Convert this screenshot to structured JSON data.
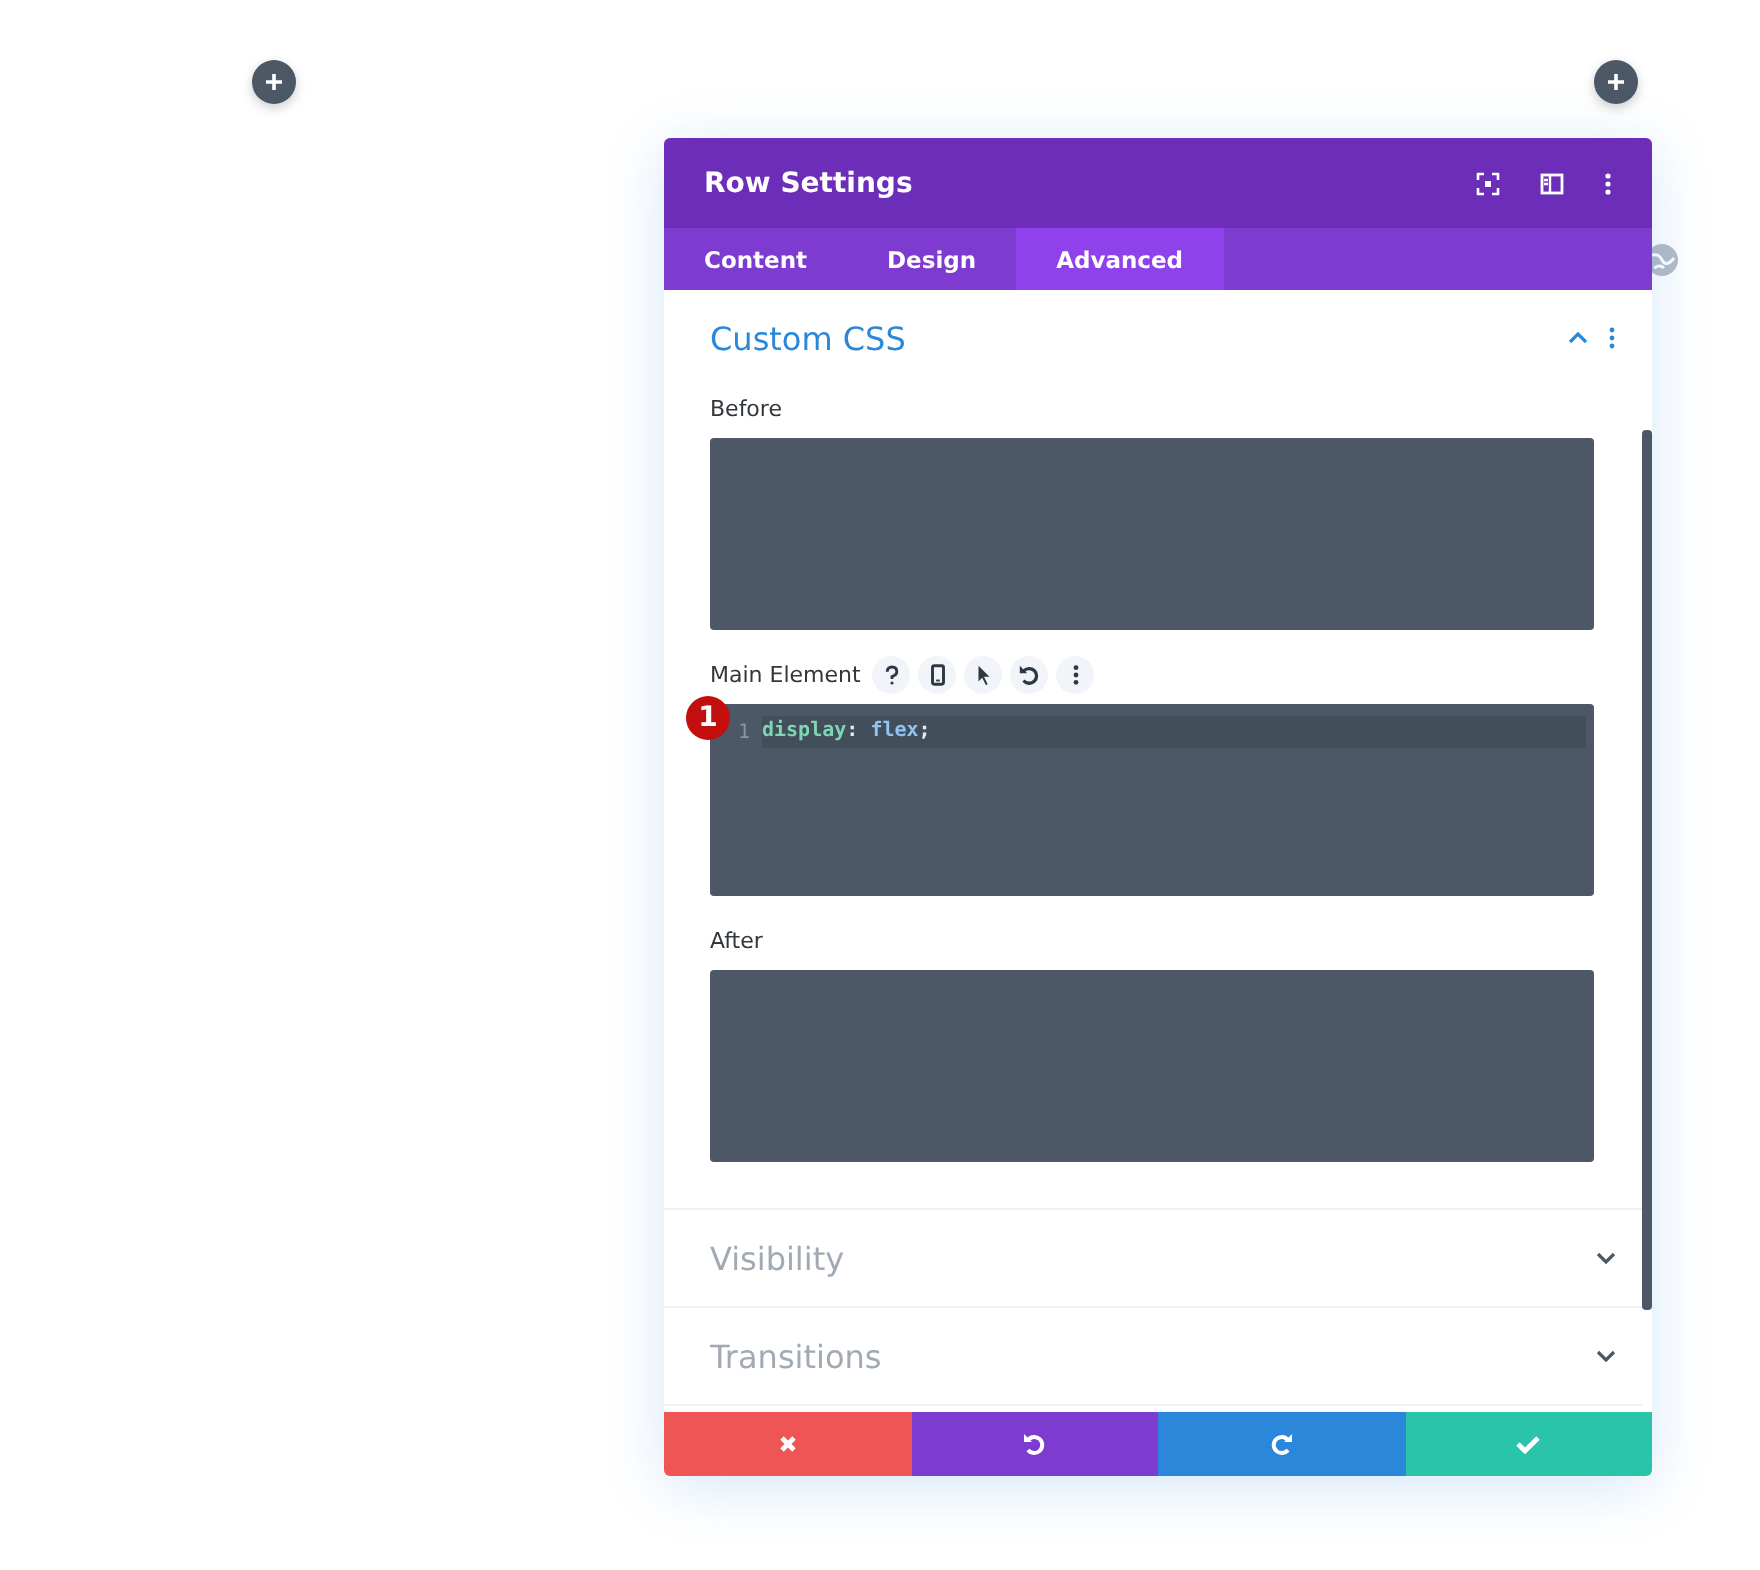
{
  "window": {
    "title": "Row Settings"
  },
  "tabs": [
    {
      "label": "Content",
      "selected": false
    },
    {
      "label": "Design",
      "selected": false
    },
    {
      "label": "Advanced",
      "selected": true
    }
  ],
  "sections": [
    {
      "title": "Custom CSS",
      "expanded": true,
      "fields": [
        {
          "label": "Before",
          "tools": false
        },
        {
          "label": "Main Element",
          "tools": true,
          "badge": "1",
          "lines": [
            {
              "number": "1",
              "tokens": [
                {
                  "text": "display",
                  "kind": "property"
                },
                {
                  "text": ":",
                  "kind": "punct"
                },
                {
                  "text": " flex",
                  "kind": "value"
                },
                {
                  "text": ";",
                  "kind": "punct"
                }
              ]
            }
          ]
        },
        {
          "label": "After",
          "tools": false
        }
      ]
    },
    {
      "title": "Visibility",
      "expanded": false
    },
    {
      "title": "Transitions",
      "expanded": false
    }
  ],
  "footer": [
    {
      "kind": "cancel"
    },
    {
      "kind": "undo"
    },
    {
      "kind": "redo"
    },
    {
      "kind": "save"
    }
  ]
}
